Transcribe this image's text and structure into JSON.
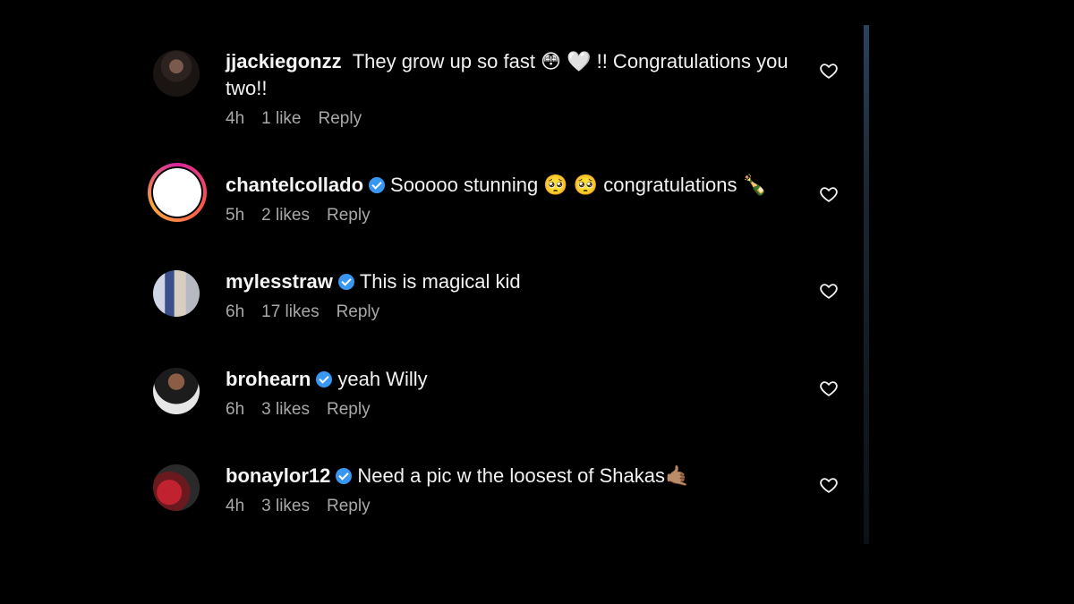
{
  "comments": [
    {
      "username": "jjackiegonzz",
      "verified": false,
      "text_line1": "They grow up so fast 😳 🤍 !! Congratulations you",
      "text_line2": "two!!",
      "time": "4h",
      "likes": "1 like",
      "reply": "Reply",
      "avatar_icon": "user-avatar"
    },
    {
      "username": "chantelcollado",
      "verified": true,
      "text_line1": "Sooooo stunning 🥺 🥺 congratulations 🍾",
      "time": "5h",
      "likes": "2 likes",
      "reply": "Reply",
      "avatar_icon": "story-ring-avatar"
    },
    {
      "username": "mylesstraw",
      "verified": true,
      "text_line1": "This is magical kid",
      "time": "6h",
      "likes": "17 likes",
      "reply": "Reply",
      "avatar_icon": "user-avatar"
    },
    {
      "username": "brohearn",
      "verified": true,
      "text_line1": "yeah Willy",
      "time": "6h",
      "likes": "3 likes",
      "reply": "Reply",
      "avatar_icon": "user-avatar"
    },
    {
      "username": "bonaylor12",
      "verified": true,
      "text_line1": "Need a pic w the loosest of Shakas🤙🏽",
      "time": "4h",
      "likes": "3 likes",
      "reply": "Reply",
      "avatar_icon": "user-avatar"
    }
  ],
  "icons": {
    "like": "heart-outline-icon",
    "verified": "verified-badge-icon"
  },
  "colors": {
    "background": "#000000",
    "text": "#f5f5f5",
    "meta": "#a8a8a8",
    "verified": "#3897f0"
  }
}
